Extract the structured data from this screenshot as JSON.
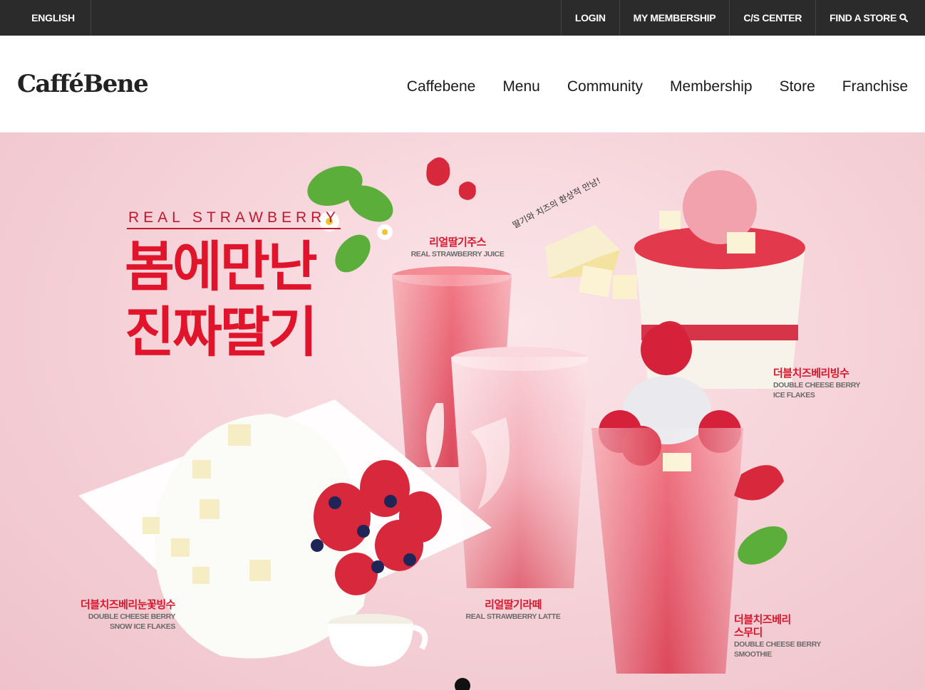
{
  "topbar": {
    "language": "ENGLISH",
    "login": "LOGIN",
    "membership": "MY MEMBERSHIP",
    "cs_center": "C/S CENTER",
    "find_store": "FIND A STORE"
  },
  "header": {
    "logo": "CafféBene",
    "nav": [
      "Caffebene",
      "Menu",
      "Community",
      "Membership",
      "Store",
      "Franchise"
    ]
  },
  "hero": {
    "eyebrow": "REAL STRAWBERRY",
    "headline_line1": "봄에만난",
    "headline_line2": "진짜딸기",
    "handwritten_note": "딸기와 치즈의 환상적 만남!",
    "products": [
      {
        "ko": "리얼딸기주스",
        "en": "REAL STRAWBERRY JUICE"
      },
      {
        "ko": "더블치즈베리빙수",
        "en_1": "DOUBLE CHEESE BERRY",
        "en_2": "ICE FLAKES"
      },
      {
        "ko": "더블치즈베리눈꽃빙수",
        "en_1": "DOUBLE CHEESE BERRY",
        "en_2": "SNOW ICE FLAKES"
      },
      {
        "ko": "리얼딸기라떼",
        "en": "REAL STRAWBERRY LATTE"
      },
      {
        "ko_1": "더블치즈베리",
        "ko_2": "스무디",
        "en_1": "DOUBLE CHEESE BERRY",
        "en_2": "SMOOTHIE"
      }
    ],
    "slide_indicator": {
      "count": 1,
      "active": 1
    }
  },
  "colors": {
    "topbar_bg": "#2b2b2b",
    "accent_red": "#e0142b",
    "hero_pink": "#f6d4da"
  }
}
